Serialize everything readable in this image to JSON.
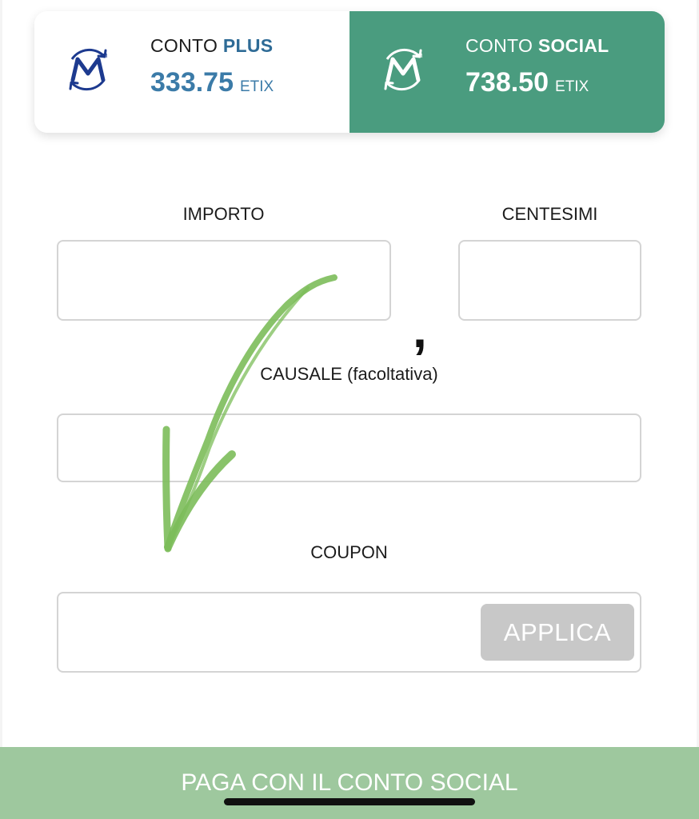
{
  "accounts": {
    "plus": {
      "title_prefix": "CONTO",
      "title_highlight": "PLUS",
      "amount": "333.75",
      "unit": "ETIX",
      "icon": "m-cycle-logo-icon",
      "color": "#2e6b96"
    },
    "social": {
      "title_prefix": "CONTO",
      "title_highlight": "SOCIAL",
      "amount": "738.50",
      "unit": "ETIX",
      "icon": "m-cycle-logo-icon",
      "color": "#4a9c7f",
      "selected": true
    }
  },
  "form": {
    "importo_label": "IMPORTO",
    "importo_value": "",
    "centesimi_label": "CENTESIMI",
    "centesimi_value": "",
    "decimal_separator": ",",
    "causale_label": "CAUSALE (facoltativa)",
    "causale_value": "",
    "coupon_label": "COUPON",
    "coupon_value": "",
    "applica_label": "APPLICA"
  },
  "footer": {
    "pay_label": "PAGA CON IL CONTO SOCIAL",
    "pay_color": "#9ec89e"
  },
  "annotation": {
    "icon": "hand-drawn-arrow-icon",
    "color": "#7cbd5a"
  }
}
